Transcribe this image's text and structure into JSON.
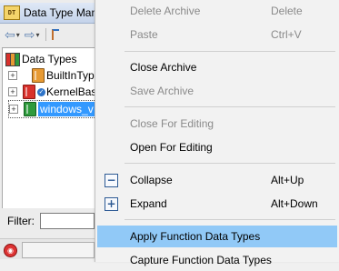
{
  "dtm": {
    "title": "Data Type Man",
    "logo_text": "DT",
    "tree": [
      {
        "label": "Data Types",
        "icon": "data-types-icon",
        "expander": "−"
      },
      {
        "label": "BuiltInTypes",
        "icon": "book-orange-icon",
        "expander": "+"
      },
      {
        "label": "KernelBase",
        "icon": "book-red-icon",
        "expander": "+",
        "badge": "✓"
      },
      {
        "label": "windows_v",
        "icon": "book-green-icon",
        "expander": "+",
        "selected": true
      }
    ],
    "filter_label": "Filter:",
    "filter_value": ""
  },
  "menu": {
    "items": [
      {
        "label": "Delete Archive",
        "shortcut": "Delete",
        "disabled": true
      },
      {
        "label": "Paste",
        "shortcut": "Ctrl+V",
        "disabled": true
      },
      {
        "label": "Close Archive",
        "shortcut": "",
        "disabled": false
      },
      {
        "label": "Save Archive",
        "shortcut": "",
        "disabled": true
      },
      {
        "label": "Close For Editing",
        "shortcut": "",
        "disabled": true
      },
      {
        "label": "Open For Editing",
        "shortcut": "",
        "disabled": false
      },
      {
        "label": "Collapse",
        "shortcut": "Alt+Up",
        "disabled": false,
        "icon": "collapse-icon",
        "icon_glyph": "−"
      },
      {
        "label": "Expand",
        "shortcut": "Alt+Down",
        "disabled": false,
        "icon": "expand-icon",
        "icon_glyph": "+"
      },
      {
        "label": "Apply Function Data Types",
        "shortcut": "",
        "disabled": false,
        "highlighted": true
      },
      {
        "label": "Capture Function Data Types",
        "shortcut": "",
        "disabled": false
      }
    ]
  },
  "colors": {
    "menu_highlight": "#91c9f7",
    "tree_selection": "#3399ff",
    "disabled_text": "#8a8a8a"
  }
}
